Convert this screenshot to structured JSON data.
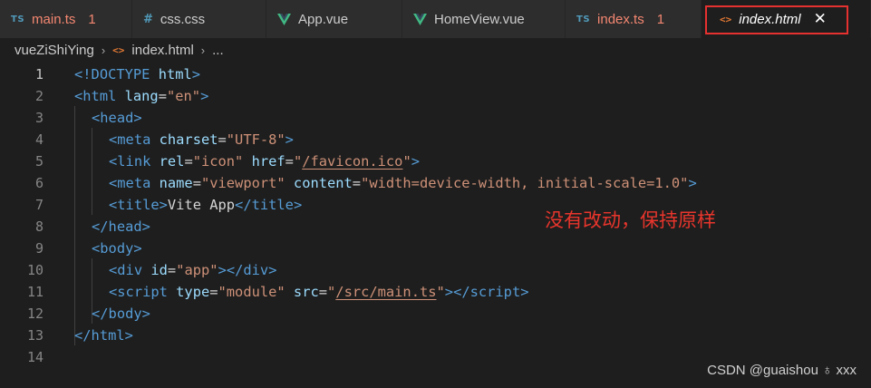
{
  "tabs": [
    {
      "label": "main.ts",
      "icon": "ts-icon",
      "badge": "1",
      "color": "#f48771"
    },
    {
      "label": "css.css",
      "icon": "css-icon",
      "badge": "",
      "color": "#cccccc"
    },
    {
      "label": "App.vue",
      "icon": "vue-icon",
      "badge": "",
      "color": "#cccccc"
    },
    {
      "label": "HomeView.vue",
      "icon": "vue-icon",
      "badge": "",
      "color": "#cccccc"
    },
    {
      "label": "index.ts",
      "icon": "ts-icon",
      "badge": "1",
      "color": "#f48771"
    },
    {
      "label": "index.html",
      "icon": "html-icon",
      "badge": "",
      "color": "#ffffff",
      "active": true,
      "close": "✕"
    }
  ],
  "icon_text": {
    "ts": "TS",
    "css": "#",
    "html": "<>"
  },
  "breadcrumb": {
    "folder": "vueZiShiYing",
    "sep1": "›",
    "file": "index.html",
    "sep2": "›",
    "more": "..."
  },
  "line_numbers": [
    "1",
    "2",
    "3",
    "4",
    "5",
    "6",
    "7",
    "8",
    "9",
    "10",
    "11",
    "12",
    "13",
    "14"
  ],
  "code": {
    "l1": {
      "open": "<!",
      "doctype": "DOCTYPE",
      "sp": " ",
      "html": "html",
      "close": ">"
    },
    "l2": {
      "lt": "<",
      "tag": "html",
      "attr": " lang",
      "eq": "=",
      "val": "\"en\"",
      "gt": ">"
    },
    "l3": {
      "lt": "<",
      "tag": "head",
      "gt": ">"
    },
    "l4": {
      "lt": "<",
      "tag": "meta",
      "attr": " charset",
      "eq": "=",
      "val": "\"UTF-8\"",
      "gt": ">"
    },
    "l5": {
      "lt": "<",
      "tag": "link",
      "attr1": " rel",
      "eq1": "=",
      "val1": "\"icon\"",
      "attr2": " href",
      "eq2": "=",
      "q1": "\"",
      "href": "/favicon.ico",
      "q2": "\"",
      "gt": ">"
    },
    "l6": {
      "lt": "<",
      "tag": "meta",
      "attr1": " name",
      "eq1": "=",
      "val1": "\"viewport\"",
      "attr2": " content",
      "eq2": "=",
      "val2": "\"width=device-width, initial-scale=1.0\"",
      "gt": ">"
    },
    "l7": {
      "lt": "<",
      "tag": "title",
      "gt": ">",
      "text": "Vite App",
      "lt2": "</",
      "tag2": "title",
      "gt2": ">"
    },
    "l8": {
      "lt": "</",
      "tag": "head",
      "gt": ">"
    },
    "l9": {
      "lt": "<",
      "tag": "body",
      "gt": ">"
    },
    "l10": {
      "lt": "<",
      "tag": "div",
      "attr": " id",
      "eq": "=",
      "val": "\"app\"",
      "gt": ">",
      "lt2": "</",
      "tag2": "div",
      "gt2": ">"
    },
    "l11": {
      "lt": "<",
      "tag": "script",
      "attr1": " type",
      "eq1": "=",
      "val1": "\"module\"",
      "attr2": " src",
      "eq2": "=",
      "q1": "\"",
      "src": "/src/main.ts",
      "q2": "\"",
      "gt": ">",
      "lt2": "</",
      "tag2": "script",
      "gt2": ">"
    },
    "l12": {
      "lt": "</",
      "tag": "body",
      "gt": ">"
    },
    "l13": {
      "lt": "</",
      "tag": "html",
      "gt": ">"
    }
  },
  "annotation": "没有改动，保持原样",
  "watermark": "CSDN @guaishou ♁ xxx",
  "colors": {
    "accent_box": "#e5312f",
    "annotation": "#e8352c",
    "vue_green": "#41b883"
  }
}
